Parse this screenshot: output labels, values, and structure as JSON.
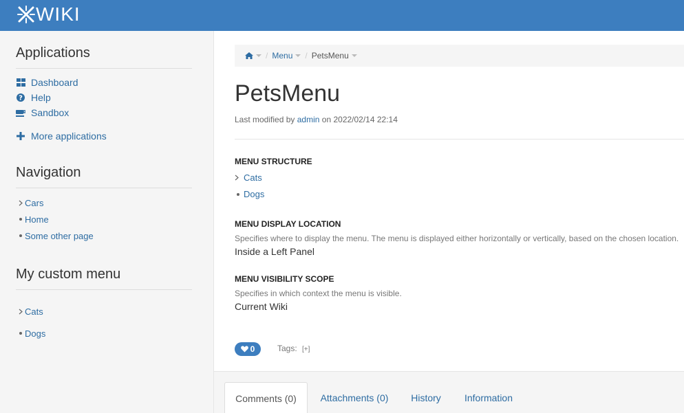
{
  "brand": {
    "logo_text": "WIKI"
  },
  "sidebar": {
    "applications": {
      "title": "Applications",
      "items": [
        {
          "label": "Dashboard",
          "icon": "dashboard-icon"
        },
        {
          "label": "Help",
          "icon": "help-icon"
        },
        {
          "label": "Sandbox",
          "icon": "sandbox-icon"
        }
      ],
      "more": {
        "label": "More applications",
        "icon": "plus-icon"
      }
    },
    "navigation": {
      "title": "Navigation",
      "items": [
        "Cars",
        "Home",
        "Some other page"
      ]
    },
    "custom_menu": {
      "title": "My custom menu",
      "items": [
        "Cats",
        "Dogs"
      ]
    }
  },
  "breadcrumb": {
    "items": [
      "Menu",
      "PetsMenu"
    ]
  },
  "document": {
    "title": "PetsMenu",
    "meta": {
      "prefix": "Last modified by",
      "author": "admin",
      "middle": "on",
      "date": "2022/02/14 22:14"
    }
  },
  "menu_structure": {
    "label": "MENU STRUCTURE",
    "items": [
      "Cats",
      "Dogs"
    ]
  },
  "display_location": {
    "label": "MENU DISPLAY LOCATION",
    "hint": "Specifies where to display the menu. The menu is displayed either horizontally or vertically, based on the chosen location.",
    "value": "Inside a Left Panel"
  },
  "visibility_scope": {
    "label": "MENU VISIBILITY SCOPE",
    "hint": "Specifies in which context the menu is visible.",
    "value": "Current Wiki"
  },
  "likes": {
    "count": "0"
  },
  "tags": {
    "label": "Tags:",
    "add": "[+]"
  },
  "tabs": [
    "Comments (0)",
    "Attachments (0)",
    "History",
    "Information"
  ],
  "colors": {
    "brand": "#3d7ebf",
    "link": "#2d6ca2"
  }
}
